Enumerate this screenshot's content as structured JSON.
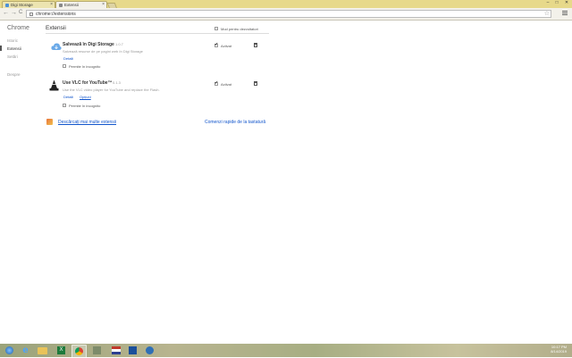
{
  "tabs": [
    {
      "title": "Digi Storage"
    },
    {
      "title": "Extensii"
    }
  ],
  "window_controls": {
    "minimize": "–",
    "maximize": "□",
    "close": "✕"
  },
  "toolbar": {
    "url": "chrome://extensions",
    "back": "←",
    "forward": "→",
    "reload": "C",
    "star": "☆"
  },
  "sidebar": {
    "brand": "Chrome",
    "items": [
      {
        "label": "Istoric"
      },
      {
        "label": "Extensii"
      },
      {
        "label": "Setări"
      },
      {
        "label": "Despre"
      }
    ]
  },
  "main": {
    "title": "Extensii",
    "dev_mode_label": "Mod pentru dezvoltatori",
    "extensions": [
      {
        "name": "Salvează în Digi Storage",
        "version": "1.0.7",
        "description": "Salvează resurse de pe pagini web în Digi Storage",
        "link_details": "Detalii",
        "incognito_label": "Permite în incognito",
        "enabled_label": "Activat",
        "icon": "cloud-icon",
        "icon_color": "#6aa9e8"
      },
      {
        "name": "Use VLC for YouTube™",
        "version": "0.1.3",
        "description": "Use the VLC video player for YouTube and replace the Flash.",
        "link_details": "Detalii",
        "link_options": "Opțiuni",
        "incognito_label": "Permite în incognito",
        "enabled_label": "Activat",
        "icon": "vlc-cone-icon",
        "icon_color": "#222222"
      }
    ],
    "more_extensions": "Descărcați mai multe extensii",
    "keyboard_shortcuts": "Comenzi rapide de la tastatură"
  },
  "taskbar": {
    "time": "10:17 PM",
    "date": "8/14/2019",
    "pinned": [
      {
        "name": "start-icon"
      },
      {
        "name": "internet-explorer-icon"
      },
      {
        "name": "file-explorer-icon"
      },
      {
        "name": "excel-icon"
      },
      {
        "name": "chrome-icon"
      },
      {
        "name": "app-icon"
      },
      {
        "name": "app-icon-2"
      },
      {
        "name": "app-icon-3"
      },
      {
        "name": "app-icon-4"
      }
    ]
  }
}
